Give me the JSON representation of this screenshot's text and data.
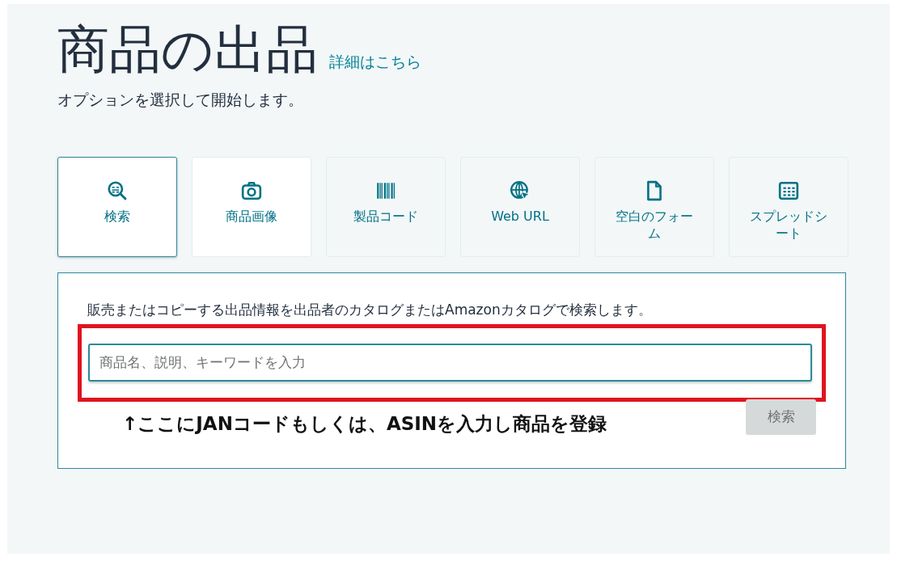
{
  "header": {
    "title": "商品の出品",
    "link": "詳細はこちら",
    "subtitle": "オプションを選択して開始します。"
  },
  "options": [
    {
      "kind": "search",
      "label": "検索",
      "selected": true,
      "hovered": false
    },
    {
      "kind": "camera",
      "label": "商品画像",
      "selected": false,
      "hovered": true
    },
    {
      "kind": "barcode",
      "label": "製品コード",
      "selected": false,
      "hovered": false
    },
    {
      "kind": "web",
      "label": "Web URL",
      "selected": false,
      "hovered": false
    },
    {
      "kind": "file",
      "label": "空白のフォーム",
      "selected": false,
      "hovered": false
    },
    {
      "kind": "sheet",
      "label": "スプレッドシート",
      "selected": false,
      "hovered": false
    }
  ],
  "panel": {
    "description": "販売またはコピーする出品情報を出品者のカタログまたはAmazonカタログで検索します。",
    "search": {
      "placeholder": "商品名、説明、キーワードを入力"
    },
    "button": {
      "label": "検索",
      "disabled": true
    },
    "annotation": "↑ここにJANコードもしくは、ASINを入力し商品を登録"
  }
}
